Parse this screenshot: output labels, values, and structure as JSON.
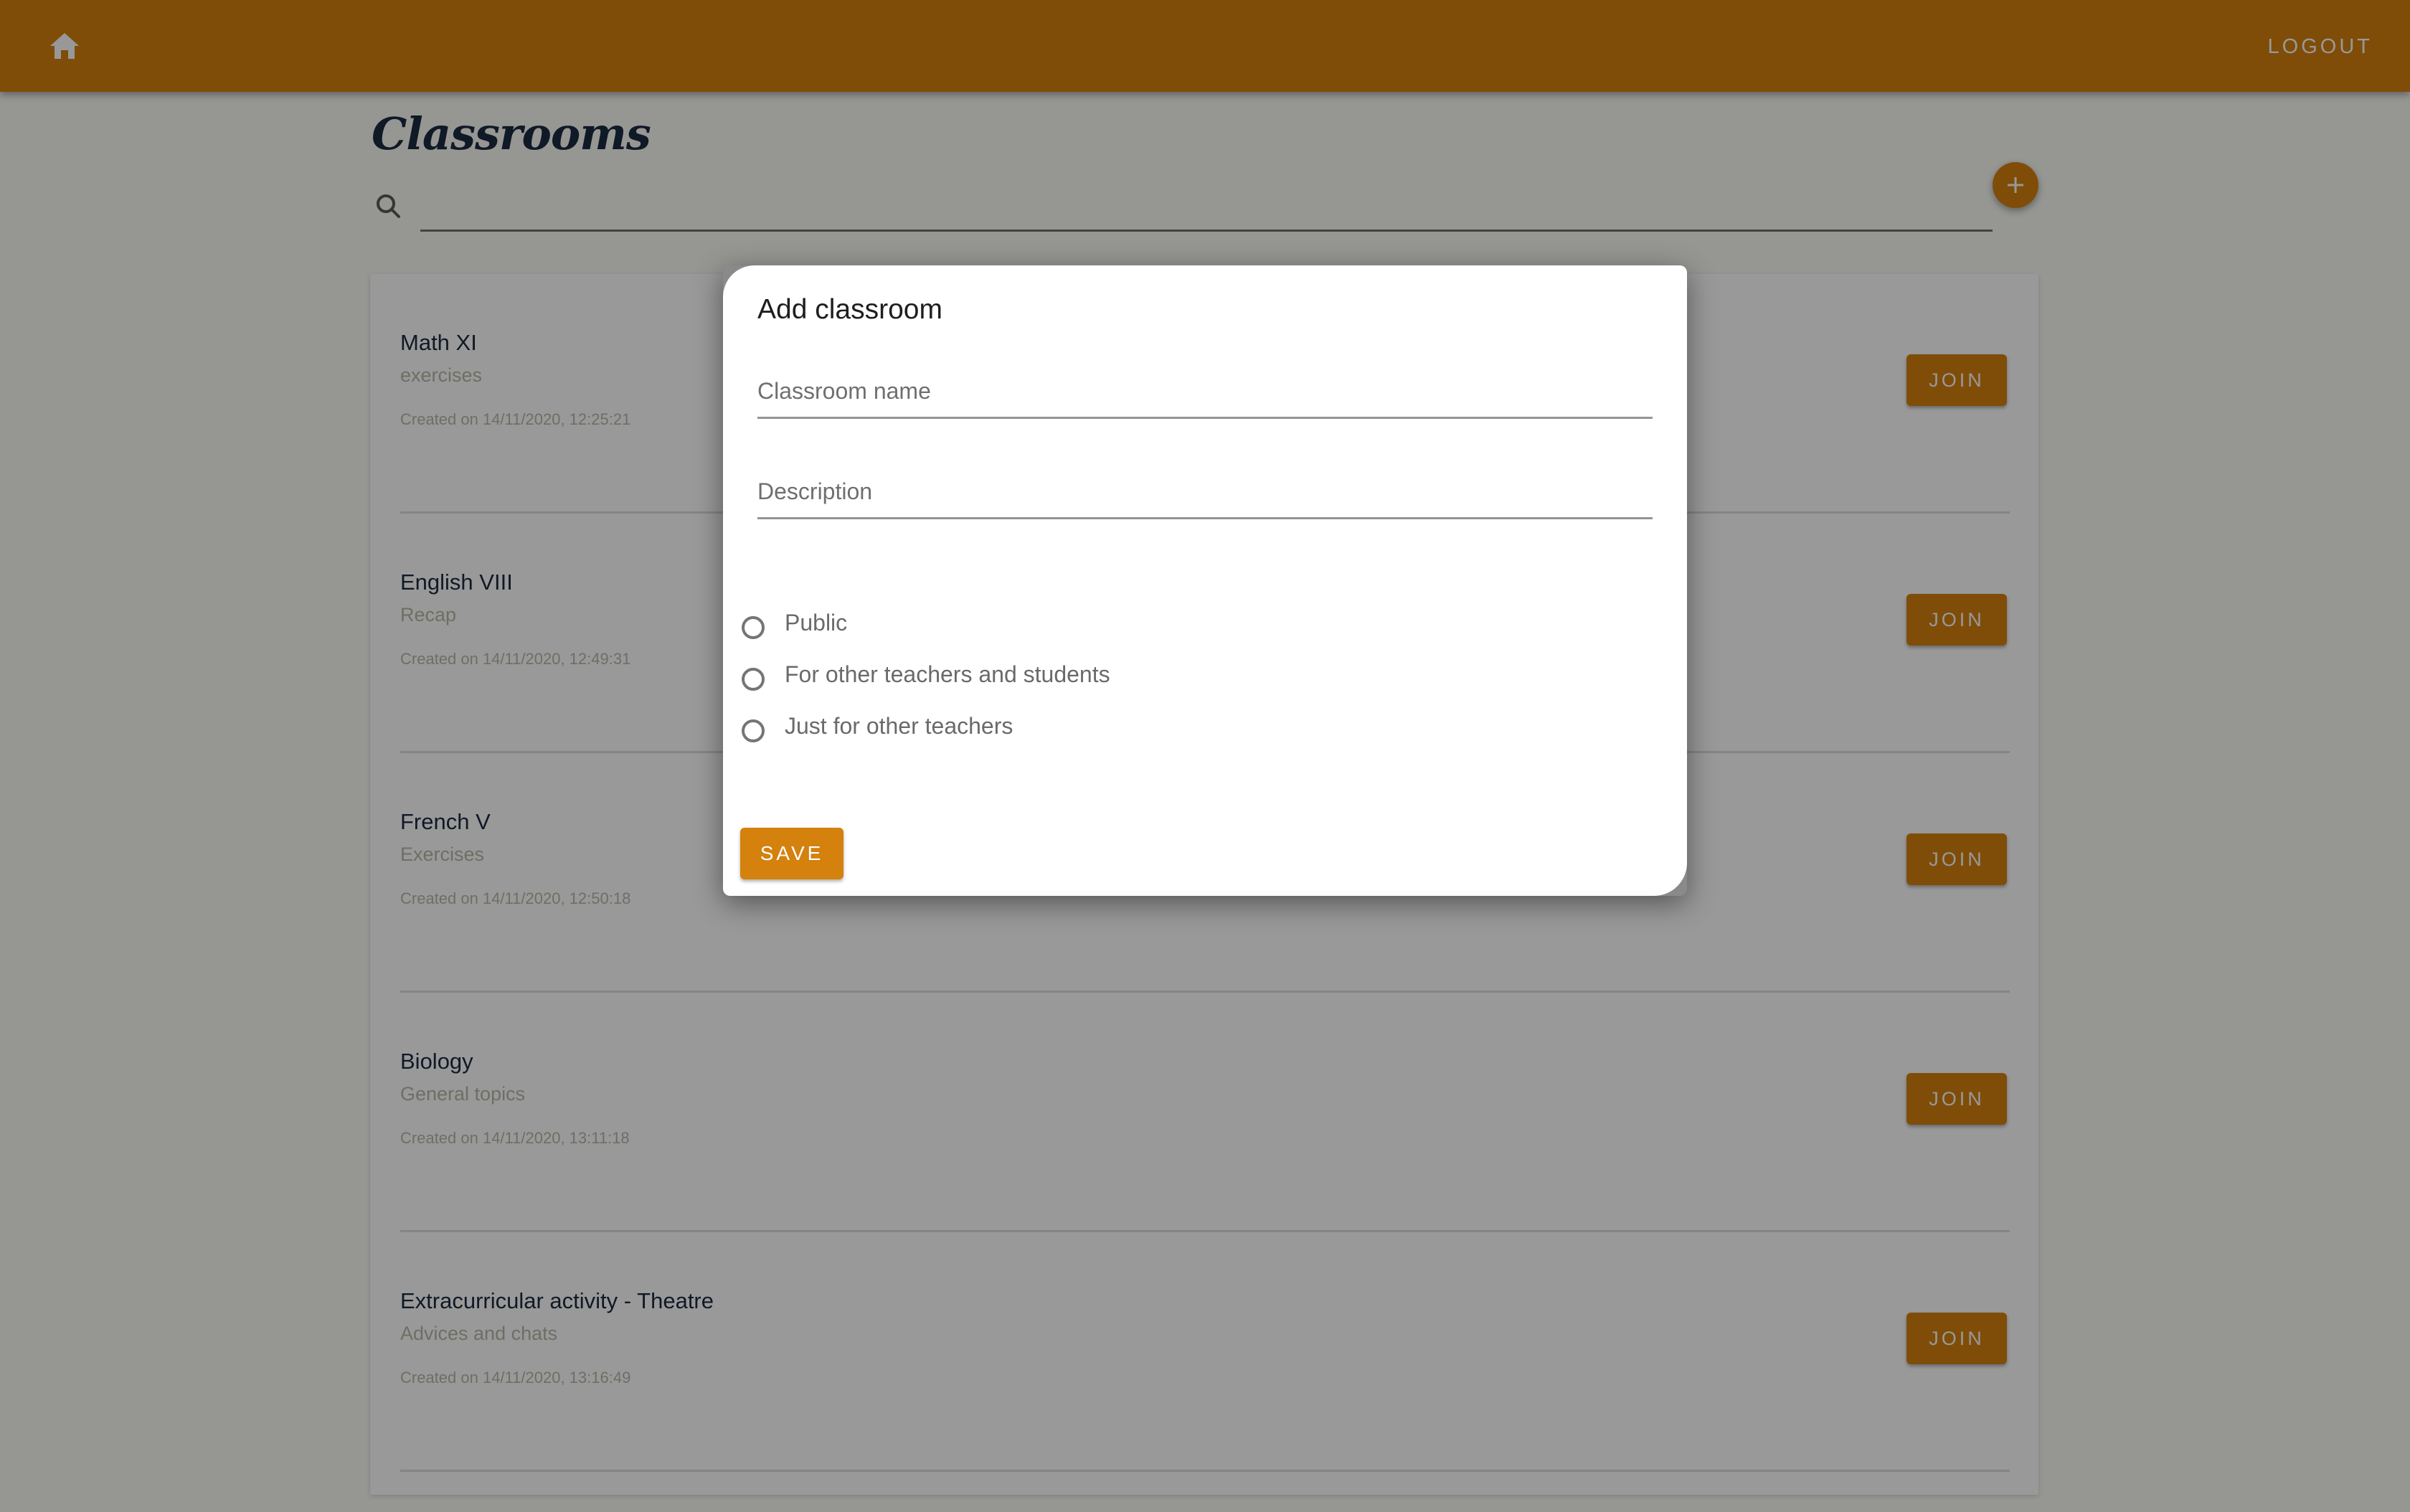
{
  "appbar": {
    "home_icon": "home-icon",
    "logout_label": "LOGOUT"
  },
  "page": {
    "title": "Classrooms",
    "search": {
      "icon": "search-icon",
      "value": "",
      "placeholder": ""
    },
    "add_button_icon": "plus-icon"
  },
  "classrooms": [
    {
      "name": "Math XI",
      "description": "exercises",
      "created": "Created on 14/11/2020, 12:25:21",
      "action": "JOIN"
    },
    {
      "name": "English VIII",
      "description": "Recap",
      "created": "Created on 14/11/2020, 12:49:31",
      "action": "JOIN"
    },
    {
      "name": "French V",
      "description": "Exercises",
      "created": "Created on 14/11/2020, 12:50:18",
      "action": "JOIN"
    },
    {
      "name": "Biology",
      "description": "General topics",
      "created": "Created on 14/11/2020, 13:11:18",
      "action": "JOIN"
    },
    {
      "name": "Extracurricular activity - Theatre",
      "description": "Advices and chats",
      "created": "Created on 14/11/2020, 13:16:49",
      "action": "JOIN"
    }
  ],
  "dialog": {
    "title": "Add classroom",
    "fields": {
      "name": {
        "placeholder": "Classroom name",
        "value": ""
      },
      "description": {
        "placeholder": "Description",
        "value": ""
      }
    },
    "visibility_options": [
      {
        "label": "Public",
        "selected": false
      },
      {
        "label": "For other teachers and students",
        "selected": false
      },
      {
        "label": "Just for other teachers",
        "selected": false
      }
    ],
    "save_label": "SAVE"
  },
  "colors": {
    "primary": "#d4810e",
    "title_text": "#1b2a40",
    "muted_text": "#b8b8a8",
    "overlay": "rgba(0,0,0,0.40)"
  }
}
